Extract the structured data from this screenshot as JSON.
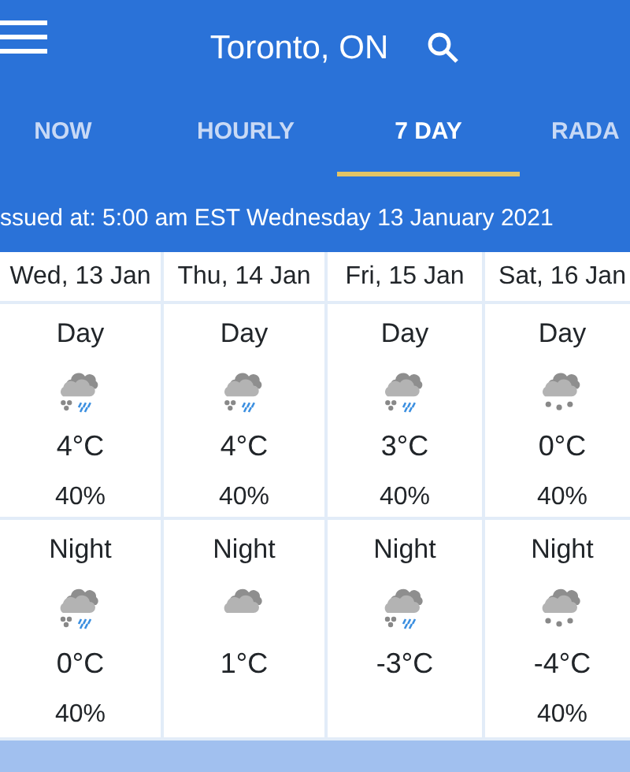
{
  "app_bar": {
    "title": "Toronto, ON"
  },
  "tabs": [
    {
      "label": "NOW",
      "selected": false
    },
    {
      "label": "HOURLY",
      "selected": false
    },
    {
      "label": "7 DAY",
      "selected": true
    },
    {
      "label": "RADA",
      "selected": false
    }
  ],
  "issued": "ssued at: 5:00 am EST Wednesday 13 January 2021",
  "days": [
    {
      "date": "Wed, 13 Jan",
      "day": {
        "label": "Day",
        "kind": "rain-snow",
        "temp": "4°C",
        "pop": "40%"
      },
      "night": {
        "label": "Night",
        "kind": "rain-snow",
        "temp": "0°C",
        "pop": "40%"
      }
    },
    {
      "date": "Thu, 14 Jan",
      "day": {
        "label": "Day",
        "kind": "rain-snow",
        "temp": "4°C",
        "pop": "40%"
      },
      "night": {
        "label": "Night",
        "kind": "cloudy",
        "temp": "1°C"
      }
    },
    {
      "date": "Fri, 15 Jan",
      "day": {
        "label": "Day",
        "kind": "rain-snow",
        "temp": "3°C",
        "pop": "40%"
      },
      "night": {
        "label": "Night",
        "kind": "rain-snow",
        "temp": "-3°C"
      }
    },
    {
      "date": "Sat, 16 Jan",
      "day": {
        "label": "Day",
        "kind": "snow",
        "temp": "0°C",
        "pop": "40%"
      },
      "night": {
        "label": "Night",
        "kind": "snow",
        "temp": "-4°C",
        "pop": "40%"
      }
    }
  ]
}
